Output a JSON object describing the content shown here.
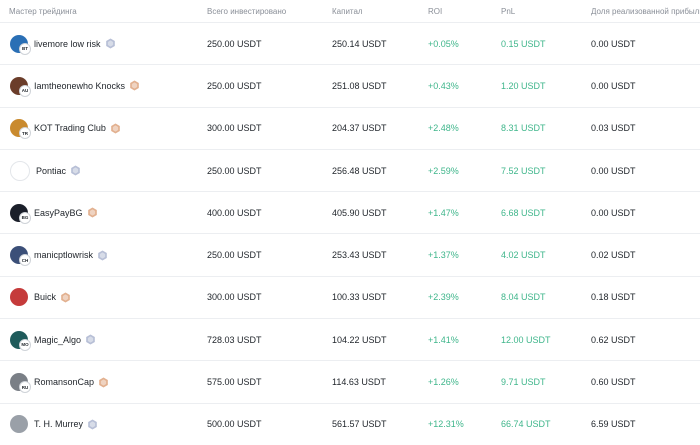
{
  "columns": {
    "trader": "Мастер трейдинга",
    "invested": "Всего инвестировано",
    "capital": "Капитал",
    "roi": "ROI",
    "pnl": "PnL",
    "share": "Доля реализованной прибыли"
  },
  "colors": {
    "positive": "#3fb68b",
    "badge_silver": "#b7bfd6",
    "badge_bronze": "#e2b08f"
  },
  "rows": [
    {
      "name": "livemore low risk",
      "initials": "BT",
      "avatar_color": "#2a6fb5",
      "badge": "silver",
      "invested": "250.00 USDT",
      "capital": "250.14 USDT",
      "roi": "+0.05%",
      "pnl": "0.15 USDT",
      "share": "0.00 USDT"
    },
    {
      "name": "Iamtheonewho Knocks",
      "initials": "AU",
      "avatar_color": "#6b3d2a",
      "badge": "bronze",
      "invested": "250.00 USDT",
      "capital": "251.08 USDT",
      "roi": "+0.43%",
      "pnl": "1.20 USDT",
      "share": "0.00 USDT"
    },
    {
      "name": "KOT Trading Club",
      "initials": "TR",
      "avatar_color": "#c98a2e",
      "badge": "bronze",
      "invested": "300.00 USDT",
      "capital": "204.37 USDT",
      "roi": "+2.48%",
      "pnl": "8.31 USDT",
      "share": "0.03 USDT"
    },
    {
      "name": "Pontiac",
      "initials": "",
      "avatar_color": "#ffffff",
      "badge": "silver",
      "invested": "250.00 USDT",
      "capital": "256.48 USDT",
      "roi": "+2.59%",
      "pnl": "7.52 USDT",
      "share": "0.00 USDT"
    },
    {
      "name": "EasyPayBG",
      "initials": "BG",
      "avatar_color": "#1b1f2a",
      "badge": "bronze",
      "invested": "400.00 USDT",
      "capital": "405.90 USDT",
      "roi": "+1.47%",
      "pnl": "6.68 USDT",
      "share": "0.00 USDT"
    },
    {
      "name": "manicptlowrisk",
      "initials": "CH",
      "avatar_color": "#3b4f78",
      "badge": "silver",
      "invested": "250.00 USDT",
      "capital": "253.43 USDT",
      "roi": "+1.37%",
      "pnl": "4.02 USDT",
      "share": "0.02 USDT"
    },
    {
      "name": "Buick",
      "initials": "",
      "avatar_color": "#c53b3b",
      "badge": "bronze",
      "invested": "300.00 USDT",
      "capital": "100.33 USDT",
      "roi": "+2.39%",
      "pnl": "8.04 USDT",
      "share": "0.18 USDT"
    },
    {
      "name": "Magic_Algo",
      "initials": "MO",
      "avatar_color": "#1f5b5b",
      "badge": "silver",
      "invested": "728.03 USDT",
      "capital": "104.22 USDT",
      "roi": "+1.41%",
      "pnl": "12.00 USDT",
      "share": "0.62 USDT"
    },
    {
      "name": "RomansonCap",
      "initials": "RU",
      "avatar_color": "#7a7f86",
      "badge": "bronze",
      "invested": "575.00 USDT",
      "capital": "114.63 USDT",
      "roi": "+1.26%",
      "pnl": "9.71 USDT",
      "share": "0.60 USDT"
    },
    {
      "name": "T. H. Murrey",
      "initials": "",
      "avatar_color": "#9aa0a8",
      "badge": "silver",
      "invested": "500.00 USDT",
      "capital": "561.57 USDT",
      "roi": "+12.31%",
      "pnl": "66.74 USDT",
      "share": "6.59 USDT"
    }
  ]
}
